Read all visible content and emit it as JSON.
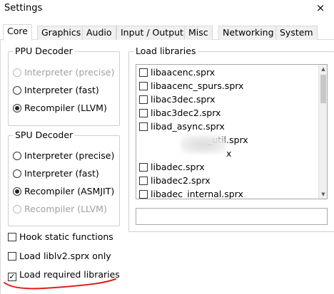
{
  "window": {
    "title": "Settings",
    "close_label": "×"
  },
  "tabs": [
    {
      "label": "Core",
      "active": true
    },
    {
      "label": "Graphics",
      "active": false
    },
    {
      "label": "Audio",
      "active": false
    },
    {
      "label": "Input / Output",
      "active": false
    },
    {
      "label": "Misc",
      "active": false
    },
    {
      "label": "Networking",
      "active": false
    },
    {
      "label": "System",
      "active": false
    }
  ],
  "ppu_decoder": {
    "title": "PPU Decoder",
    "options": [
      {
        "label": "Interpreter (precise)",
        "selected": false,
        "enabled": false
      },
      {
        "label": "Interpreter (fast)",
        "selected": false,
        "enabled": true
      },
      {
        "label": "Recompiler (LLVM)",
        "selected": true,
        "enabled": true
      }
    ]
  },
  "spu_decoder": {
    "title": "SPU Decoder",
    "options": [
      {
        "label": "Interpreter (precise)",
        "selected": false,
        "enabled": true
      },
      {
        "label": "Interpreter (fast)",
        "selected": false,
        "enabled": true
      },
      {
        "label": "Recompiler (ASMJIT)",
        "selected": true,
        "enabled": true
      },
      {
        "label": "Recompiler (LLVM)",
        "selected": false,
        "enabled": false
      }
    ]
  },
  "checkboxes": [
    {
      "label": "Hook static functions",
      "checked": false
    },
    {
      "label": "Load liblv2.sprx only",
      "checked": false
    },
    {
      "label": "Load required libraries",
      "checked": true
    }
  ],
  "load_libraries": {
    "title": "Load libraries",
    "items": [
      {
        "label": "libaacenc.sprx",
        "checked": false
      },
      {
        "label": "libaacenc_spurs.sprx",
        "checked": false
      },
      {
        "label": "libac3dec.sprx",
        "checked": false
      },
      {
        "label": "libac3dec2.sprx",
        "checked": false
      },
      {
        "label": "libad_async.sprx",
        "checked": false
      },
      {
        "label": "_util.sprx",
        "checked": false
      },
      {
        "label": "x",
        "checked": false
      },
      {
        "label": "libadec.sprx",
        "checked": false
      },
      {
        "label": "libadec2.sprx",
        "checked": false
      },
      {
        "label": "libadec_internal.sprx",
        "checked": false
      }
    ],
    "search_value": ""
  },
  "colors": {
    "annotation_red": "#e0201a"
  }
}
